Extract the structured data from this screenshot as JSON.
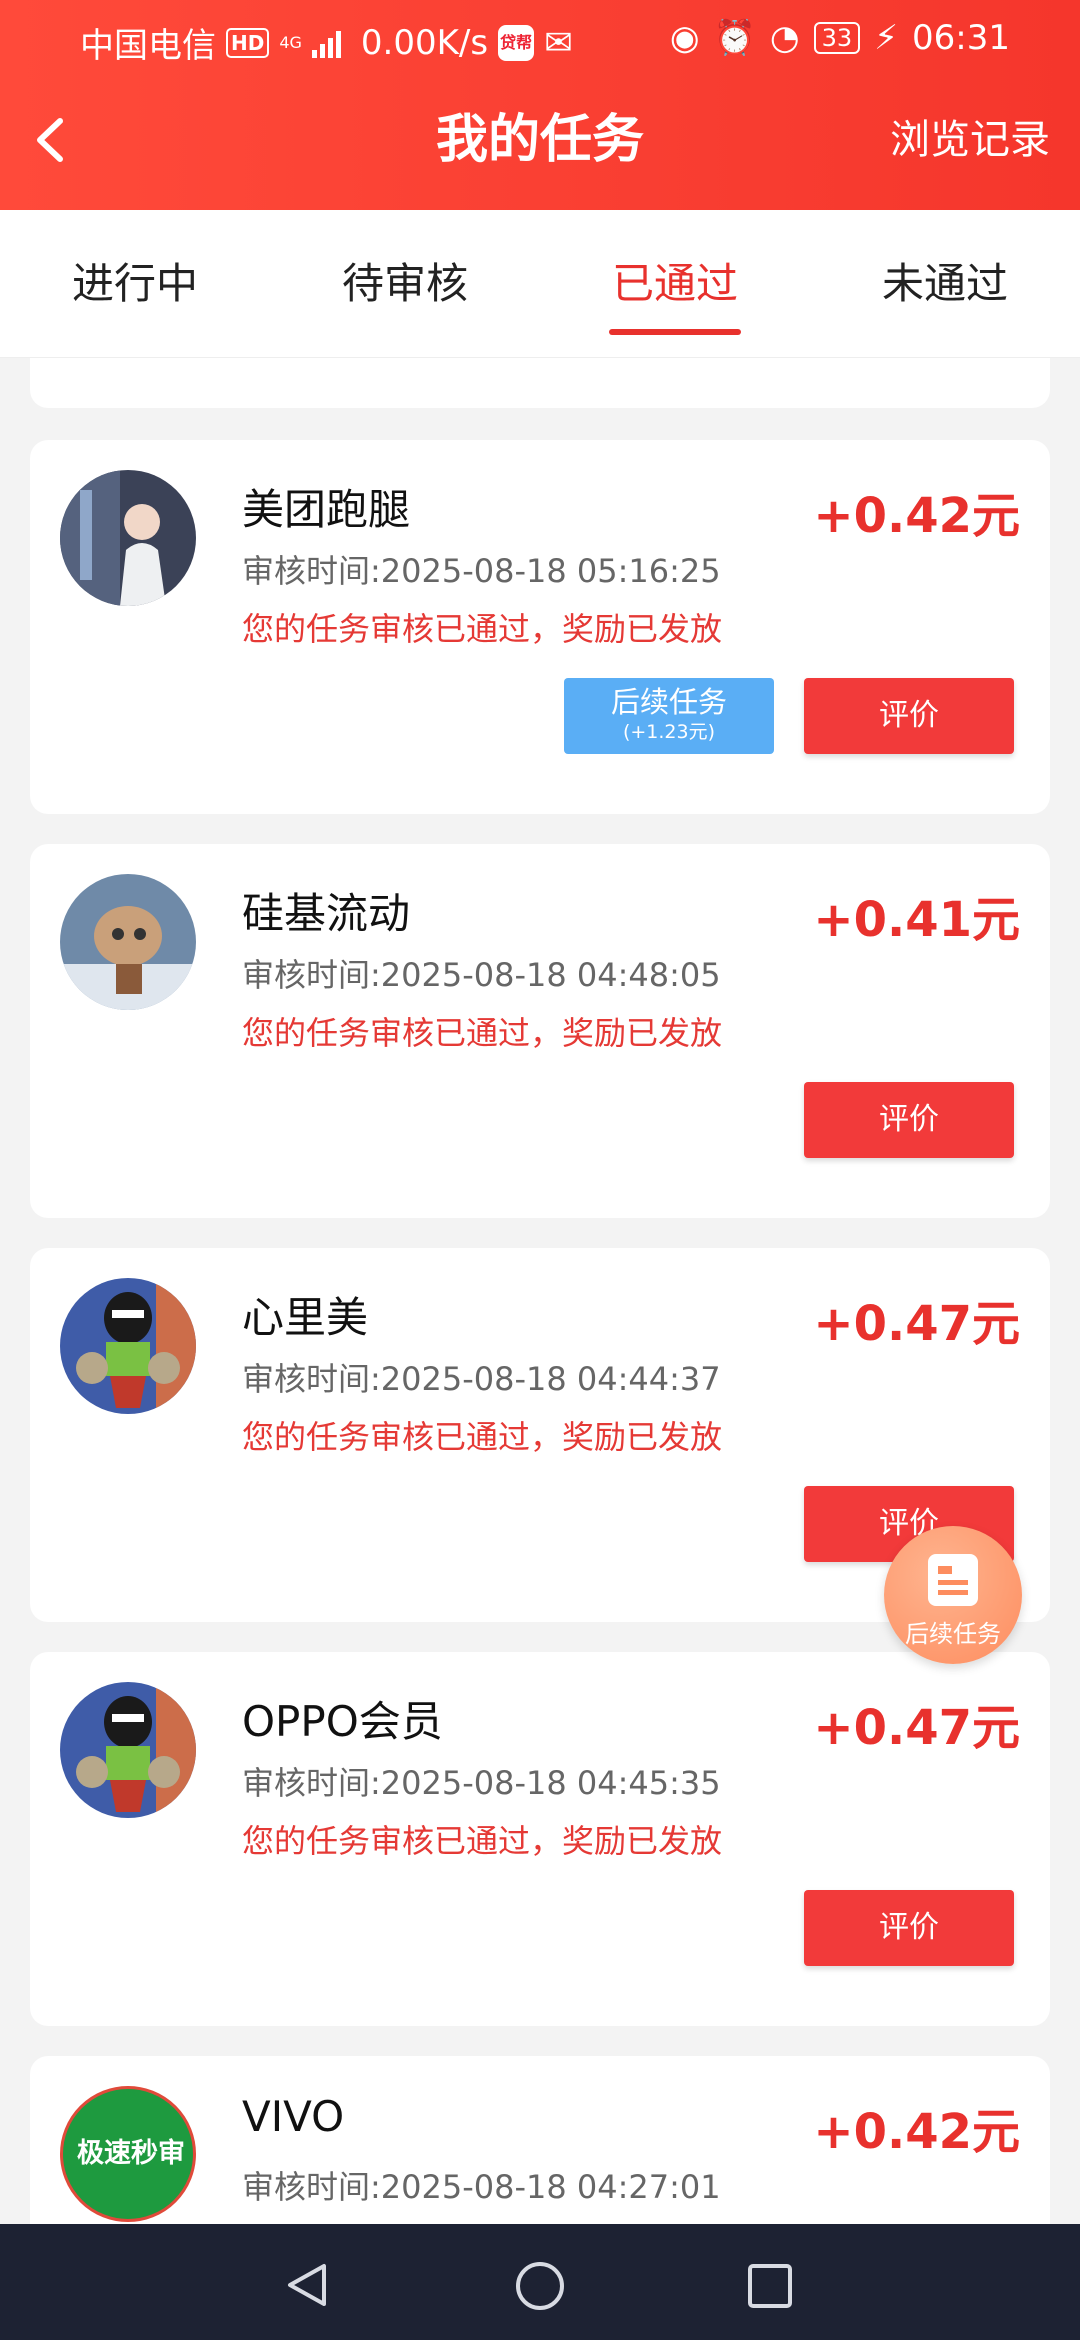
{
  "status_bar": {
    "carrier": "中国电信",
    "hd": "HD",
    "network": "4G",
    "speed": "0.00K/s",
    "app_badge": "贷帮",
    "battery": "33",
    "time": "06:31"
  },
  "header": {
    "title": "我的任务",
    "history_label": "浏览记录"
  },
  "tabs": [
    {
      "label": "进行中"
    },
    {
      "label": "待审核"
    },
    {
      "label": "已通过",
      "active": true
    },
    {
      "label": "未通过"
    }
  ],
  "tasks": [
    {
      "name": "美团跑腿",
      "time": "审核时间:2025-08-18 05:16:25",
      "status": "您的任务审核已通过，奖励已发放",
      "amount": "+0.42元",
      "follow_label": "后续任务",
      "follow_bonus": "(+1.23元)",
      "eval_label": "评价"
    },
    {
      "name": "硅基流动",
      "time": "审核时间:2025-08-18 04:48:05",
      "status": "您的任务审核已通过，奖励已发放",
      "amount": "+0.41元",
      "eval_label": "评价"
    },
    {
      "name": "心里美",
      "time": "审核时间:2025-08-18 04:44:37",
      "status": "您的任务审核已通过，奖励已发放",
      "amount": "+0.47元",
      "eval_label": "评价"
    },
    {
      "name": "OPPO会员",
      "time": "审核时间:2025-08-18 04:45:35",
      "status": "您的任务审核已通过，奖励已发放",
      "amount": "+0.47元",
      "eval_label": "评价"
    },
    {
      "name": "VIVO",
      "time": "审核时间:2025-08-18 04:27:01",
      "amount": "+0.42元",
      "avatar_text": "极速秒审"
    }
  ],
  "fab": {
    "label": "后续任务"
  },
  "colors": {
    "primary": "#e8312d",
    "follow_button": "#5aaef5",
    "fab": "#fd8d5f"
  }
}
